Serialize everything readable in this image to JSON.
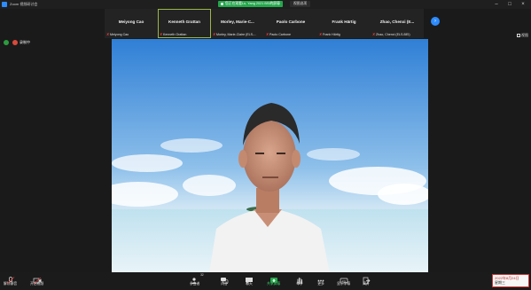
{
  "window": {
    "title": "Zoom 视频研讨会",
    "share_banner": "您正在观看Lu, Yang 2021 BSI的屏幕",
    "view_options": "视图选项",
    "controls": [
      "–",
      "□",
      "×"
    ]
  },
  "participants": [
    {
      "name": "Meiyong Cao",
      "label": "Meiyong Cao",
      "active": false
    },
    {
      "name": "Kenneth Grattan",
      "label": "Kenneth Grattan",
      "active": true
    },
    {
      "name": "Morley,  Marie-C...",
      "label": "Morley, Marie-Claire (ELS-...",
      "active": false
    },
    {
      "name": "Paolo Carbone",
      "label": "Paolo Carbone",
      "active": false
    },
    {
      "name": "Frank Härtig",
      "label": "Frank Härtig",
      "active": false
    },
    {
      "name": "Zhao, Chenxi (E...",
      "label": "Zhao, Chenxi (ELS-BEI)",
      "active": false
    }
  ],
  "strip_nav": {
    "next_icon": "chevron-right-icon"
  },
  "view_button": {
    "label": "视图"
  },
  "recording": {
    "label": "录制中"
  },
  "toolbar": {
    "unmute": "解除静音",
    "start_video": "开启视频",
    "participants": "参会者",
    "participants_count": "32",
    "qa": "问答",
    "chat": "聊天",
    "share_screen": "共享屏幕",
    "raise_hand": "举手",
    "more": "更多",
    "captions": "显示字幕",
    "leave": "离开"
  },
  "timestamp": {
    "date": "2022年8月24日",
    "weekday": "星期三"
  },
  "colors": {
    "accent_blue": "#2d8cff",
    "share_green": "#23a84b",
    "active_border": "#9ab84a",
    "mic_red": "#e23a3a"
  }
}
